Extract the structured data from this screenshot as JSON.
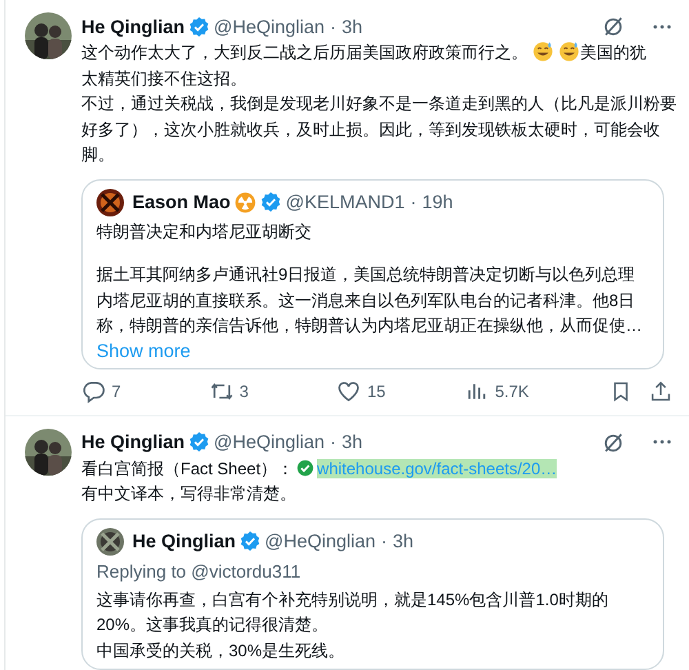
{
  "tweets": [
    {
      "author": {
        "name": "He Qinglian",
        "verified": true,
        "handle": "@HeQinglian",
        "separator": "·",
        "time": "3h"
      },
      "paragraphs": [
        [
          {
            "kind": "text",
            "text": "这个动作太大了，大到反二战之后历届美国政府政策而行之。"
          },
          {
            "kind": "emoji"
          },
          {
            "kind": "emoji"
          },
          {
            "kind": "text",
            "text": "美国的犹"
          },
          {
            "kind": "text",
            "text": "太精英们接不住这招。"
          }
        ],
        [
          {
            "kind": "text",
            "text": "不过，通过关税战，我倒是发现老川好象不是一条道走到黑的人（比凡是派川粉要好多了），这次小胜就收兵，及时止损。因此，等到发现铁板太硬时，可能会收脚。"
          }
        ]
      ],
      "quote": {
        "author": {
          "name": "Eason Mao",
          "emoji_after_name": true,
          "verified": true,
          "handle": "@KELMAND1",
          "separator": "·",
          "time": "19h"
        },
        "blank_line_between_paragraphs": true,
        "paragraphs": [
          [
            {
              "kind": "text",
              "text": "特朗普决定和内塔尼亚胡断交"
            }
          ],
          [
            {
              "kind": "text",
              "text": "据土耳其阿纳多卢通讯社9日报道，美国总统特朗普决定切断与以色列总理内塔尼亚胡的直接联系。这一消息来自以色列军队电台的记者科津。他8日称，特朗普的亲信告诉他，特朗普认为内塔尼亚胡正在操纵他，从而促使…"
            }
          ]
        ],
        "show_more": "Show more"
      },
      "actions": {
        "replies": "7",
        "reposts": "3",
        "likes": "15",
        "views": "5.7K"
      }
    },
    {
      "author": {
        "name": "He Qinglian",
        "verified": true,
        "handle": "@HeQinglian",
        "separator": "·",
        "time": "3h"
      },
      "paragraphs": [
        [
          {
            "kind": "text",
            "text": "看白宫简报（Fact Sheet）："
          },
          {
            "kind": "check"
          },
          {
            "kind": "link",
            "text": "whitehouse.gov/fact-sheets/20…"
          }
        ],
        [
          {
            "kind": "text",
            "text": "有中文译本，写得非常清楚。"
          }
        ]
      ],
      "quote": {
        "author": {
          "name": "He Qinglian",
          "verified": true,
          "handle": "@HeQinglian",
          "separator": "·",
          "time": "3h"
        },
        "replying_to": "Replying to @victordu311",
        "paragraphs": [
          [
            {
              "kind": "text",
              "text": "这事请你再查，白宫有个补充特别说明，就是145%包含川普1.0时期的20%。这事我真的记得很清楚。"
            }
          ],
          [
            {
              "kind": "text",
              "text": "中国承受的关税，30%是生死线。"
            }
          ]
        ]
      }
    }
  ]
}
